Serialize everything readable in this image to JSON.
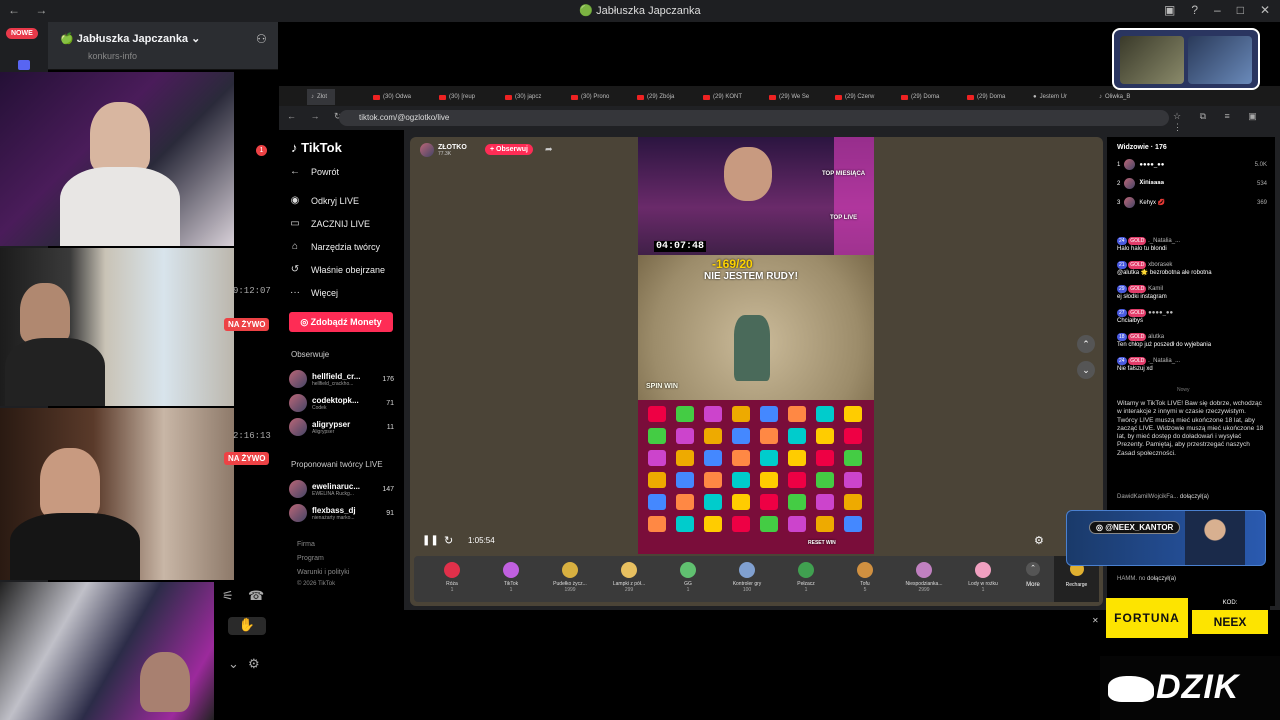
{
  "window": {
    "title": "🟢 Jabłuszka Japczanka"
  },
  "discord": {
    "badge_new": "NOWE",
    "server_name": "Jabłuszka Japczanka",
    "channel_hint": "konkurs-info",
    "mention_count": "1",
    "streams": [
      {
        "timer": "",
        "live": ""
      },
      {
        "timer": "9:12:07",
        "live": "NA ŻYWO"
      },
      {
        "timer": "2:16:13",
        "live": "NA ŻYWO"
      }
    ]
  },
  "browser": {
    "url": "tiktok.com/@ogzlotko/live",
    "tabs": [
      "Złot",
      "(30) Odwa",
      "(30) [reup",
      "(30) japcz",
      "(30) Prono",
      "(29) Zbója",
      "(29) KONT",
      "(29) We Se",
      "(29) Czerw",
      "(29) Doma",
      "(29) Doma",
      "Jestem Ur",
      "Oliwka_B"
    ]
  },
  "tiktok": {
    "logo": "TikTok",
    "back": "Powrót",
    "menu": [
      "Odkryj LIVE",
      "ZACZNIJ LIVE",
      "Narzędzia twórcy",
      "Właśnie obejrzane",
      "Więcej"
    ],
    "coins_button": "Zdobądź Monety",
    "following_title": "Obserwuje",
    "following": [
      {
        "name": "hellfield_cr...",
        "sub": "hellfield_crackho...",
        "count": "176"
      },
      {
        "name": "codektopk...",
        "sub": "Codek",
        "count": "71"
      },
      {
        "name": "aligrypser",
        "sub": "Aligrypser",
        "count": "11"
      }
    ],
    "suggested_title": "Proponowani twórcy LIVE",
    "suggested": [
      {
        "name": "ewelinaruc...",
        "sub": "EWELINA Ruckg...",
        "count": "147"
      },
      {
        "name": "flexbass_dj",
        "sub": "nienażarty marko...",
        "count": "91"
      }
    ],
    "footer": [
      "Firma",
      "Program",
      "Warunki i polityki",
      "© 2026 TikTok"
    ]
  },
  "stream": {
    "streamer": "ZŁOTKO",
    "viewers_badge": "77.3K",
    "follow": "+ Obserwuj",
    "elapsed": "1:05:54",
    "overlay": {
      "top_month": "TOP MIESIĄCA",
      "top_live": "TOP LIVE",
      "timer": "04:07:48",
      "score": "-169/20",
      "banner": "NIE JESTEM RUDY!",
      "spin": "SPIN WIN",
      "reset": "RESET WIN"
    },
    "gifts": [
      {
        "name": "Róża",
        "price": "1",
        "color": "#e0304a"
      },
      {
        "name": "TikTok",
        "price": "1",
        "color": "#c060e0"
      },
      {
        "name": "Pudełko życz...",
        "price": "1999",
        "color": "#d8b040"
      },
      {
        "name": "Lampki z pół...",
        "price": "299",
        "color": "#e8c060"
      },
      {
        "name": "GG",
        "price": "1",
        "color": "#60c070"
      },
      {
        "name": "Kontroler gry",
        "price": "100",
        "color": "#80a0d0"
      },
      {
        "name": "Pełzacz",
        "price": "1",
        "color": "#40a050"
      },
      {
        "name": "Tofu",
        "price": "5",
        "color": "#d09040"
      },
      {
        "name": "Niespodzianka...",
        "price": "2999",
        "color": "#c080c0"
      },
      {
        "name": "Lody w rożku",
        "price": "1",
        "color": "#f0a0c0"
      }
    ],
    "more": "More",
    "recharge": "Recharge"
  },
  "chat": {
    "viewers_label": "Widzowie · 176",
    "top_viewers": [
      {
        "rank": "1",
        "name": "●●●●_●●",
        "value": "5.0K"
      },
      {
        "rank": "2",
        "name": "𝐗𝐢𝐧𝐢𝐚𝐚𝐚𝐚",
        "value": "534"
      },
      {
        "rank": "3",
        "name": "Kehyx 💋",
        "value": "369"
      }
    ],
    "messages": [
      {
        "level": "24",
        "user": "._Natalia_...",
        "text": "Halo halo tu blondi"
      },
      {
        "level": "21",
        "user": "xborasek",
        "text": "@alutka 🌟 bezrobotna ale robotna"
      },
      {
        "level": "29",
        "user": "Kamil",
        "text": "ej słodki instagram"
      },
      {
        "level": "27",
        "user": "●●●●_●●",
        "text": "Chciałbyś"
      },
      {
        "level": "18",
        "user": "alutka",
        "text": "Ten chłop już poszedł do wyjebania"
      },
      {
        "level": "24",
        "user": "._Natalia_...",
        "text": "Nie fałszuj xd"
      }
    ],
    "divider": "Nowy",
    "system": "Witamy w TikTok LIVE! Baw się dobrze, wchodząc w interakcje z innymi w czasie rzeczywistym. Twórcy LIVE muszą mieć ukończone 18 lat, aby zacząć LIVE. Widzowie muszą mieć ukończone 18 lat, by mieć dostęp do doładowań i wysyłać Prezenty. Pamiętaj, aby przestrzegać naszych Zasad społeczności.",
    "joined1_user": "DawidKamilWojcikFa...",
    "joined1": "dołączył(a)",
    "joined2_user": "HAMM. no",
    "joined2": "dołączył(a)"
  },
  "ads": {
    "neex_tag": "@NEEX_KANTOR",
    "fortuna": "FORTUNA",
    "kod_label": "KOD:",
    "kod": "NEEX",
    "dzik": "DZIK"
  }
}
